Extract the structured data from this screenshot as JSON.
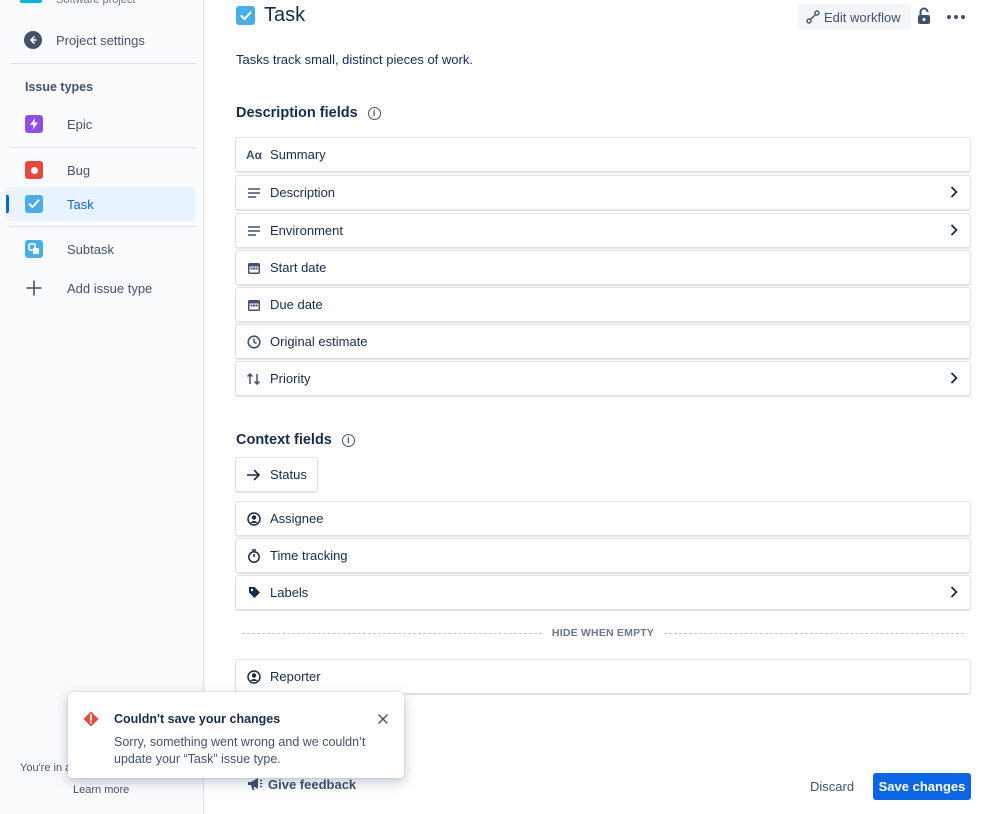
{
  "sidebar": {
    "project_type": "Software project",
    "project_settings": "Project settings",
    "issue_types_heading": "Issue types",
    "items": [
      {
        "label": "Epic",
        "color": "#904EE2"
      },
      {
        "label": "Bug",
        "color": "#E5493A"
      },
      {
        "label": "Task",
        "color": "#4BADE8"
      },
      {
        "label": "Subtask",
        "color": "#4BADE8"
      }
    ],
    "add_issue_type": "Add issue type",
    "footer_text": "You're in a",
    "learn_more": "Learn more"
  },
  "header": {
    "title": "Task",
    "edit_workflow": "Edit workflow",
    "description": "Tasks track small, distinct pieces of work."
  },
  "description_fields": {
    "title": "Description fields",
    "items": [
      {
        "label": "Summary",
        "icon": "text-icon"
      },
      {
        "label": "Description",
        "icon": "lines-icon"
      },
      {
        "label": "Environment",
        "icon": "lines-icon"
      },
      {
        "label": "Start date",
        "icon": "calendar-icon"
      },
      {
        "label": "Due date",
        "icon": "calendar-icon"
      },
      {
        "label": "Original estimate",
        "icon": "clock-icon"
      },
      {
        "label": "Priority",
        "icon": "priority-icon"
      }
    ]
  },
  "context_fields": {
    "title": "Context fields",
    "status": "Status",
    "items": [
      {
        "label": "Assignee",
        "icon": "person-icon"
      },
      {
        "label": "Time tracking",
        "icon": "stopwatch-icon"
      },
      {
        "label": "Labels",
        "icon": "tag-icon"
      }
    ],
    "hide_when_empty": "HIDE WHEN EMPTY",
    "hidden_items": [
      {
        "label": "Reporter",
        "icon": "person-icon"
      }
    ]
  },
  "footer": {
    "give_feedback": "Give feedback",
    "discard": "Discard",
    "save_changes": "Save changes"
  },
  "flag": {
    "title": "Couldn't save your changes",
    "body": "Sorry, something went wrong and we couldn’t update your “Task” issue type."
  }
}
